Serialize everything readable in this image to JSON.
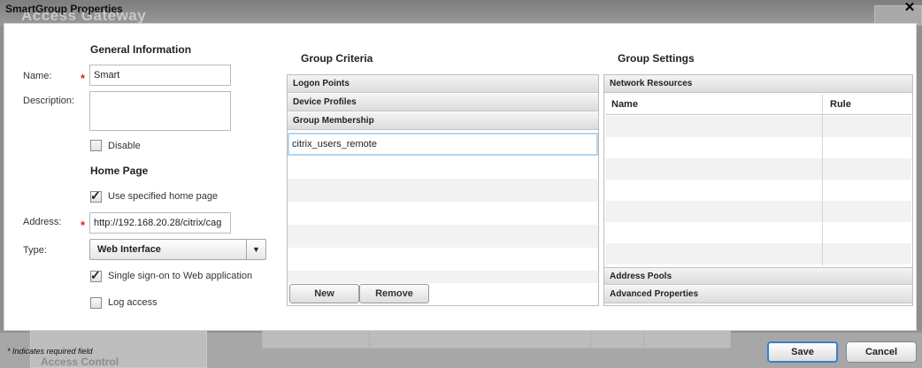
{
  "window": {
    "title": "SmartGroup Properties",
    "background_app_title": "Access Gateway",
    "background_nav_item": "Access Control"
  },
  "general": {
    "section_title": "General Information",
    "name_label": "Name:",
    "name_value": "Smart",
    "description_label": "Description:",
    "description_value": "",
    "disable_label": "Disable",
    "disable_checked": false
  },
  "home_page": {
    "section_title": "Home Page",
    "use_home_page_label": "Use specified home page",
    "use_home_page_checked": true,
    "address_label": "Address:",
    "address_value": "http://192.168.20.28/citrix/cag",
    "type_label": "Type:",
    "type_value": "Web Interface",
    "sso_label": "Single sign-on to Web application",
    "sso_checked": true,
    "log_access_label": "Log access",
    "log_access_checked": false
  },
  "required_marker": "*",
  "group_criteria": {
    "section_title": "Group Criteria",
    "sections": [
      "Logon Points",
      "Device Profiles",
      "Group Membership"
    ],
    "members": [
      "citrix_users_remote"
    ],
    "new_label": "New",
    "remove_label": "Remove"
  },
  "group_settings": {
    "section_title": "Group Settings",
    "network_resources_label": "Network Resources",
    "columns": [
      "Name",
      "Rule"
    ],
    "address_pools_label": "Address Pools",
    "advanced_properties_label": "Advanced Properties"
  },
  "footer": {
    "required_note": "* Indicates required field",
    "save_label": "Save",
    "cancel_label": "Cancel"
  },
  "icons": {
    "close": "close-icon",
    "dropdown": "chevron-down-icon",
    "checkmark": "check-icon"
  }
}
